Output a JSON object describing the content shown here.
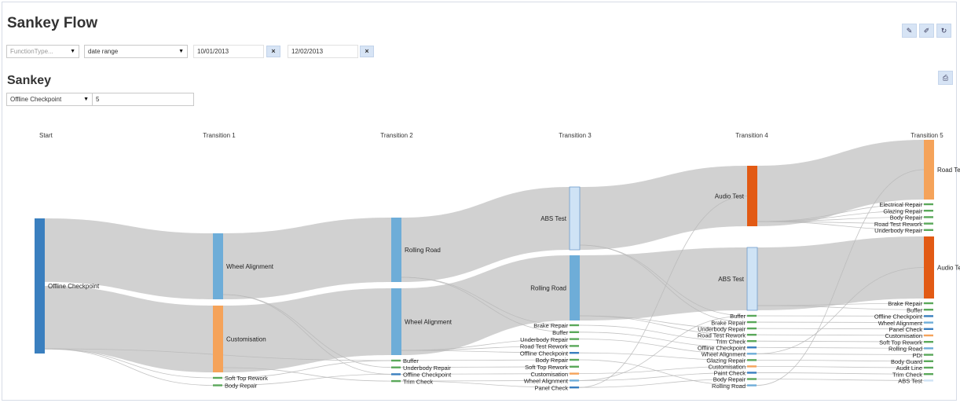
{
  "page": {
    "title": "Sankey Flow",
    "section_title": "Sankey"
  },
  "filters": {
    "function_type_placeholder": "FunctionType...",
    "date_range": "date range",
    "start_date": "10/01/2013",
    "end_date": "12/02/2013",
    "clear_glyph": "×"
  },
  "sankey_controls": {
    "start_node": "Offline Checkpoint",
    "depth": "5"
  },
  "toolbar_icons": [
    "pencil-icon",
    "edit-icon",
    "refresh-icon"
  ],
  "print_icon": "print-icon",
  "colors": {
    "link": "#cfcfcf",
    "dark_blue": "#3a7fbf",
    "mid_blue": "#6eadd8",
    "light_blue": "#cfe3f5",
    "orange": "#f5a35a",
    "dark_orange": "#e25a14",
    "green": "#5aa85a"
  },
  "sankey": {
    "columns": [
      "Start",
      "Transition 1",
      "Transition 2",
      "Transition 3",
      "Transition 4",
      "Transition 5"
    ],
    "nodes": [
      {
        "id": "s_oc",
        "col": 0,
        "label": "Offline Checkpoint",
        "color": "dark_blue",
        "size": "large",
        "seg": [
          0,
          100
        ]
      },
      {
        "id": "t1_wa",
        "col": 1,
        "label": "Wheel Alignment",
        "color": "mid_blue",
        "size": "large",
        "seg": [
          0,
          49
        ]
      },
      {
        "id": "t1_cu",
        "col": 1,
        "label": "Customisation",
        "color": "orange",
        "size": "large",
        "seg": [
          54,
          100
        ]
      },
      {
        "id": "t1_st",
        "col": 1,
        "label": "Soft Top Rework",
        "color": "green",
        "size": "small",
        "slot": "t1-0"
      },
      {
        "id": "t1_br",
        "col": 1,
        "label": "Body Repair",
        "color": "green",
        "size": "small",
        "slot": "t1-1"
      },
      {
        "id": "t2_rr",
        "col": 2,
        "label": "Rolling Road",
        "color": "mid_blue",
        "size": "large",
        "seg": [
          0,
          37
        ]
      },
      {
        "id": "t2_wa",
        "col": 2,
        "label": "Wheel Alignment",
        "color": "mid_blue",
        "size": "large",
        "seg": [
          41,
          81
        ]
      },
      {
        "id": "t2_bu",
        "col": 2,
        "label": "Buffer",
        "color": "green",
        "size": "small",
        "slot": "t2-0"
      },
      {
        "id": "t2_ur",
        "col": 2,
        "label": "Underbody Repair",
        "color": "green",
        "size": "small",
        "slot": "t2-1"
      },
      {
        "id": "t2_oc",
        "col": 2,
        "label": "Offline Checkpoint",
        "color": "dark_blue",
        "size": "small",
        "slot": "t2-2"
      },
      {
        "id": "t2_tc",
        "col": 2,
        "label": "Trim Check",
        "color": "green",
        "size": "small",
        "slot": "t2-3"
      },
      {
        "id": "t3_abs",
        "col": 3,
        "label": "ABS Test",
        "color": "light_blue",
        "size": "large",
        "seg": [
          0,
          34
        ]
      },
      {
        "id": "t3_rr",
        "col": 3,
        "label": "Rolling Road",
        "color": "mid_blue",
        "size": "large",
        "seg": [
          37,
          73
        ]
      },
      {
        "id": "t3_brr",
        "col": 3,
        "label": "Brake Repair",
        "color": "green",
        "size": "small",
        "slot": "t3-0"
      },
      {
        "id": "t3_bu",
        "col": 3,
        "label": "Buffer",
        "color": "green",
        "size": "small",
        "slot": "t3-1"
      },
      {
        "id": "t3_ur",
        "col": 3,
        "label": "Underbody Repair",
        "color": "green",
        "size": "small",
        "slot": "t3-2"
      },
      {
        "id": "t3_rtr",
        "col": 3,
        "label": "Road Test Rework",
        "color": "green",
        "size": "small",
        "slot": "t3-3"
      },
      {
        "id": "t3_oc",
        "col": 3,
        "label": "Offline Checkpoint",
        "color": "dark_blue",
        "size": "small",
        "slot": "t3-4"
      },
      {
        "id": "t3_br",
        "col": 3,
        "label": "Body Repair",
        "color": "green",
        "size": "small",
        "slot": "t3-5"
      },
      {
        "id": "t3_str",
        "col": 3,
        "label": "Soft Top Rework",
        "color": "green",
        "size": "small",
        "slot": "t3-6"
      },
      {
        "id": "t3_cu",
        "col": 3,
        "label": "Customisation",
        "color": "orange",
        "size": "small",
        "slot": "t3-7"
      },
      {
        "id": "t3_wa",
        "col": 3,
        "label": "Wheel Alignment",
        "color": "mid_blue",
        "size": "small",
        "slot": "t3-8"
      },
      {
        "id": "t3_pc",
        "col": 3,
        "label": "Panel Check",
        "color": "dark_blue",
        "size": "small",
        "slot": "t3-9"
      },
      {
        "id": "t4_at",
        "col": 4,
        "label": "Audio Test",
        "color": "dark_orange",
        "size": "large",
        "seg": [
          0,
          36
        ]
      },
      {
        "id": "t4_bu",
        "col": 4,
        "label": "Buffer",
        "color": "green",
        "size": "small",
        "slot": "t4-0"
      },
      {
        "id": "t4_abs",
        "col": 4,
        "label": "ABS Test",
        "color": "light_blue",
        "size": "large",
        "seg": [
          43,
          80
        ]
      },
      {
        "id": "t4_brr",
        "col": 4,
        "label": "Brake Repair",
        "color": "green",
        "size": "small",
        "slot": "t4-1"
      },
      {
        "id": "t4_ur",
        "col": 4,
        "label": "Underbody Repair",
        "color": "green",
        "size": "small",
        "slot": "t4-2"
      },
      {
        "id": "t4_rtr",
        "col": 4,
        "label": "Road Test Rework",
        "color": "green",
        "size": "small",
        "slot": "t4-3"
      },
      {
        "id": "t4_tc",
        "col": 4,
        "label": "Trim Check",
        "color": "green",
        "size": "small",
        "slot": "t4-4"
      },
      {
        "id": "t4_oc",
        "col": 4,
        "label": "Offline Checkpoint",
        "color": "dark_blue",
        "size": "small",
        "slot": "t4-5"
      },
      {
        "id": "t4_wa",
        "col": 4,
        "label": "Wheel Alignment",
        "color": "mid_blue",
        "size": "small",
        "slot": "t4-6"
      },
      {
        "id": "t4_gr",
        "col": 4,
        "label": "Glazing Repair",
        "color": "green",
        "size": "small",
        "slot": "t4-7"
      },
      {
        "id": "t4_cu",
        "col": 4,
        "label": "Customisation",
        "color": "orange",
        "size": "small",
        "slot": "t4-8"
      },
      {
        "id": "t4_pc",
        "col": 4,
        "label": "Paint Check",
        "color": "dark_blue",
        "size": "small",
        "slot": "t4-9"
      },
      {
        "id": "t4_br",
        "col": 4,
        "label": "Body Repair",
        "color": "green",
        "size": "small",
        "slot": "t4-10"
      },
      {
        "id": "t4_rr",
        "col": 4,
        "label": "Rolling Road",
        "color": "mid_blue",
        "size": "small",
        "slot": "t4-11"
      },
      {
        "id": "t5_rt",
        "col": 5,
        "label": "Road Test",
        "color": "orange",
        "size": "large",
        "seg": [
          0,
          24
        ]
      },
      {
        "id": "t5_er",
        "col": 5,
        "label": "Electrical Repair",
        "color": "green",
        "size": "small",
        "slot": "t5a-0"
      },
      {
        "id": "t5_gr",
        "col": 5,
        "label": "Glazing Repair",
        "color": "green",
        "size": "small",
        "slot": "t5a-1"
      },
      {
        "id": "t5_br1",
        "col": 5,
        "label": "Body Repair",
        "color": "green",
        "size": "small",
        "slot": "t5a-2"
      },
      {
        "id": "t5_rtr",
        "col": 5,
        "label": "Road Test Rework",
        "color": "green",
        "size": "small",
        "slot": "t5a-3"
      },
      {
        "id": "t5_ur",
        "col": 5,
        "label": "Underbody Repair",
        "color": "green",
        "size": "small",
        "slot": "t5a-4"
      },
      {
        "id": "t5_at",
        "col": 5,
        "label": "Audio Test",
        "color": "dark_orange",
        "size": "large",
        "seg": [
          39,
          65
        ]
      },
      {
        "id": "t5_brr",
        "col": 5,
        "label": "Brake Repair",
        "color": "green",
        "size": "small",
        "slot": "t5b-0"
      },
      {
        "id": "t5_bu",
        "col": 5,
        "label": "Buffer",
        "color": "green",
        "size": "small",
        "slot": "t5b-1"
      },
      {
        "id": "t5_oc",
        "col": 5,
        "label": "Offline Checkpoint",
        "color": "dark_blue",
        "size": "small",
        "slot": "t5b-2"
      },
      {
        "id": "t5_wa",
        "col": 5,
        "label": "Wheel Alignment",
        "color": "mid_blue",
        "size": "small",
        "slot": "t5b-3"
      },
      {
        "id": "t5_pc",
        "col": 5,
        "label": "Panel Check",
        "color": "dark_blue",
        "size": "small",
        "slot": "t5b-4"
      },
      {
        "id": "t5_cu",
        "col": 5,
        "label": "Customisation",
        "color": "orange",
        "size": "small",
        "slot": "t5b-5"
      },
      {
        "id": "t5_str",
        "col": 5,
        "label": "Soft Top Rework",
        "color": "green",
        "size": "small",
        "slot": "t5b-6"
      },
      {
        "id": "t5_rr",
        "col": 5,
        "label": "Rolling Road",
        "color": "mid_blue",
        "size": "small",
        "slot": "t5b-7"
      },
      {
        "id": "t5_pdi",
        "col": 5,
        "label": "PDI",
        "color": "green",
        "size": "small",
        "slot": "t5b-8"
      },
      {
        "id": "t5_bg",
        "col": 5,
        "label": "Body Guard",
        "color": "green",
        "size": "small",
        "slot": "t5b-9"
      },
      {
        "id": "t5_al",
        "col": 5,
        "label": "Audit Line",
        "color": "green",
        "size": "small",
        "slot": "t5b-10"
      },
      {
        "id": "t5_tc",
        "col": 5,
        "label": "Trim Check",
        "color": "green",
        "size": "small",
        "slot": "t5b-11"
      },
      {
        "id": "t5_abs",
        "col": 5,
        "label": "ABS Test",
        "color": "light_blue",
        "size": "small",
        "slot": "t5b-12"
      }
    ],
    "flows": [
      {
        "from": "s_oc",
        "to": "t1_wa",
        "band": [
          0,
          47
        ],
        "band2": [
          0,
          49
        ]
      },
      {
        "from": "s_oc",
        "to": "t1_cu",
        "band": [
          50,
          97
        ],
        "band2": [
          0,
          100
        ]
      },
      {
        "from": "t1_wa",
        "to": "t2_rr",
        "band": [
          0,
          100
        ],
        "band2": [
          0,
          100
        ]
      },
      {
        "from": "t1_cu",
        "to": "t2_wa",
        "band": [
          0,
          100
        ],
        "band2": [
          0,
          100
        ]
      },
      {
        "from": "t2_rr",
        "to": "t3_abs",
        "band": [
          0,
          100
        ],
        "band2": [
          0,
          100
        ]
      },
      {
        "from": "t2_wa",
        "to": "t3_rr",
        "band": [
          0,
          100
        ],
        "band2": [
          0,
          100
        ]
      },
      {
        "from": "t3_abs",
        "to": "t4_at",
        "band": [
          0,
          100
        ],
        "band2": [
          0,
          100
        ]
      },
      {
        "from": "t3_rr",
        "to": "t4_abs",
        "band": [
          0,
          100
        ],
        "band2": [
          0,
          100
        ]
      },
      {
        "from": "t4_at",
        "to": "t5_rt",
        "band": [
          0,
          100
        ],
        "band2": [
          0,
          100
        ]
      },
      {
        "from": "t4_abs",
        "to": "t5_at",
        "band": [
          0,
          100
        ],
        "band2": [
          0,
          100
        ]
      }
    ],
    "thin_flows": [
      [
        "s_oc",
        "t1_st"
      ],
      [
        "s_oc",
        "t1_br"
      ],
      [
        "s_oc",
        "t2_bu"
      ],
      [
        "t1_wa",
        "t2_ur"
      ],
      [
        "t1_wa",
        "t2_oc"
      ],
      [
        "t1_cu",
        "t2_tc"
      ],
      [
        "t1_st",
        "t2_bu"
      ],
      [
        "t1_br",
        "t2_oc"
      ],
      [
        "t2_rr",
        "t3_brr"
      ],
      [
        "t2_rr",
        "t3_bu"
      ],
      [
        "t2_wa",
        "t3_ur"
      ],
      [
        "t2_wa",
        "t3_rtr"
      ],
      [
        "t2_wa",
        "t3_oc"
      ],
      [
        "t2_bu",
        "t3_br"
      ],
      [
        "t2_ur",
        "t3_str"
      ],
      [
        "t2_oc",
        "t3_cu"
      ],
      [
        "t2_tc",
        "t3_wa"
      ],
      [
        "t2_tc",
        "t3_pc"
      ],
      [
        "t3_abs",
        "t4_brr"
      ],
      [
        "t3_abs",
        "t4_bu"
      ],
      [
        "t3_rr",
        "t4_ur"
      ],
      [
        "t3_rr",
        "t4_rtr"
      ],
      [
        "t3_brr",
        "t4_tc"
      ],
      [
        "t3_bu",
        "t4_oc"
      ],
      [
        "t3_ur",
        "t4_wa"
      ],
      [
        "t3_oc",
        "t4_gr"
      ],
      [
        "t3_cu",
        "t4_cu"
      ],
      [
        "t3_wa",
        "t4_pc"
      ],
      [
        "t3_pc",
        "t4_br"
      ],
      [
        "t3_br",
        "t4_rr"
      ],
      [
        "t3_pc",
        "t4_at"
      ],
      [
        "t3_wa",
        "t4_bu"
      ],
      [
        "t4_at",
        "t5_er"
      ],
      [
        "t4_at",
        "t5_gr"
      ],
      [
        "t4_at",
        "t5_br1"
      ],
      [
        "t4_at",
        "t5_rtr"
      ],
      [
        "t4_at",
        "t5_ur"
      ],
      [
        "t4_abs",
        "t5_brr"
      ],
      [
        "t4_abs",
        "t5_bu"
      ],
      [
        "t4_bu",
        "t5_oc"
      ],
      [
        "t4_brr",
        "t5_wa"
      ],
      [
        "t4_ur",
        "t5_pc"
      ],
      [
        "t4_rtr",
        "t5_cu"
      ],
      [
        "t4_tc",
        "t5_str"
      ],
      [
        "t4_oc",
        "t5_rr"
      ],
      [
        "t4_wa",
        "t5_pdi"
      ],
      [
        "t4_gr",
        "t5_bg"
      ],
      [
        "t4_cu",
        "t5_al"
      ],
      [
        "t4_pc",
        "t5_tc"
      ],
      [
        "t4_br",
        "t5_abs"
      ],
      [
        "t4_rr",
        "t5_rt"
      ],
      [
        "t4_wa",
        "t5_at"
      ]
    ]
  }
}
